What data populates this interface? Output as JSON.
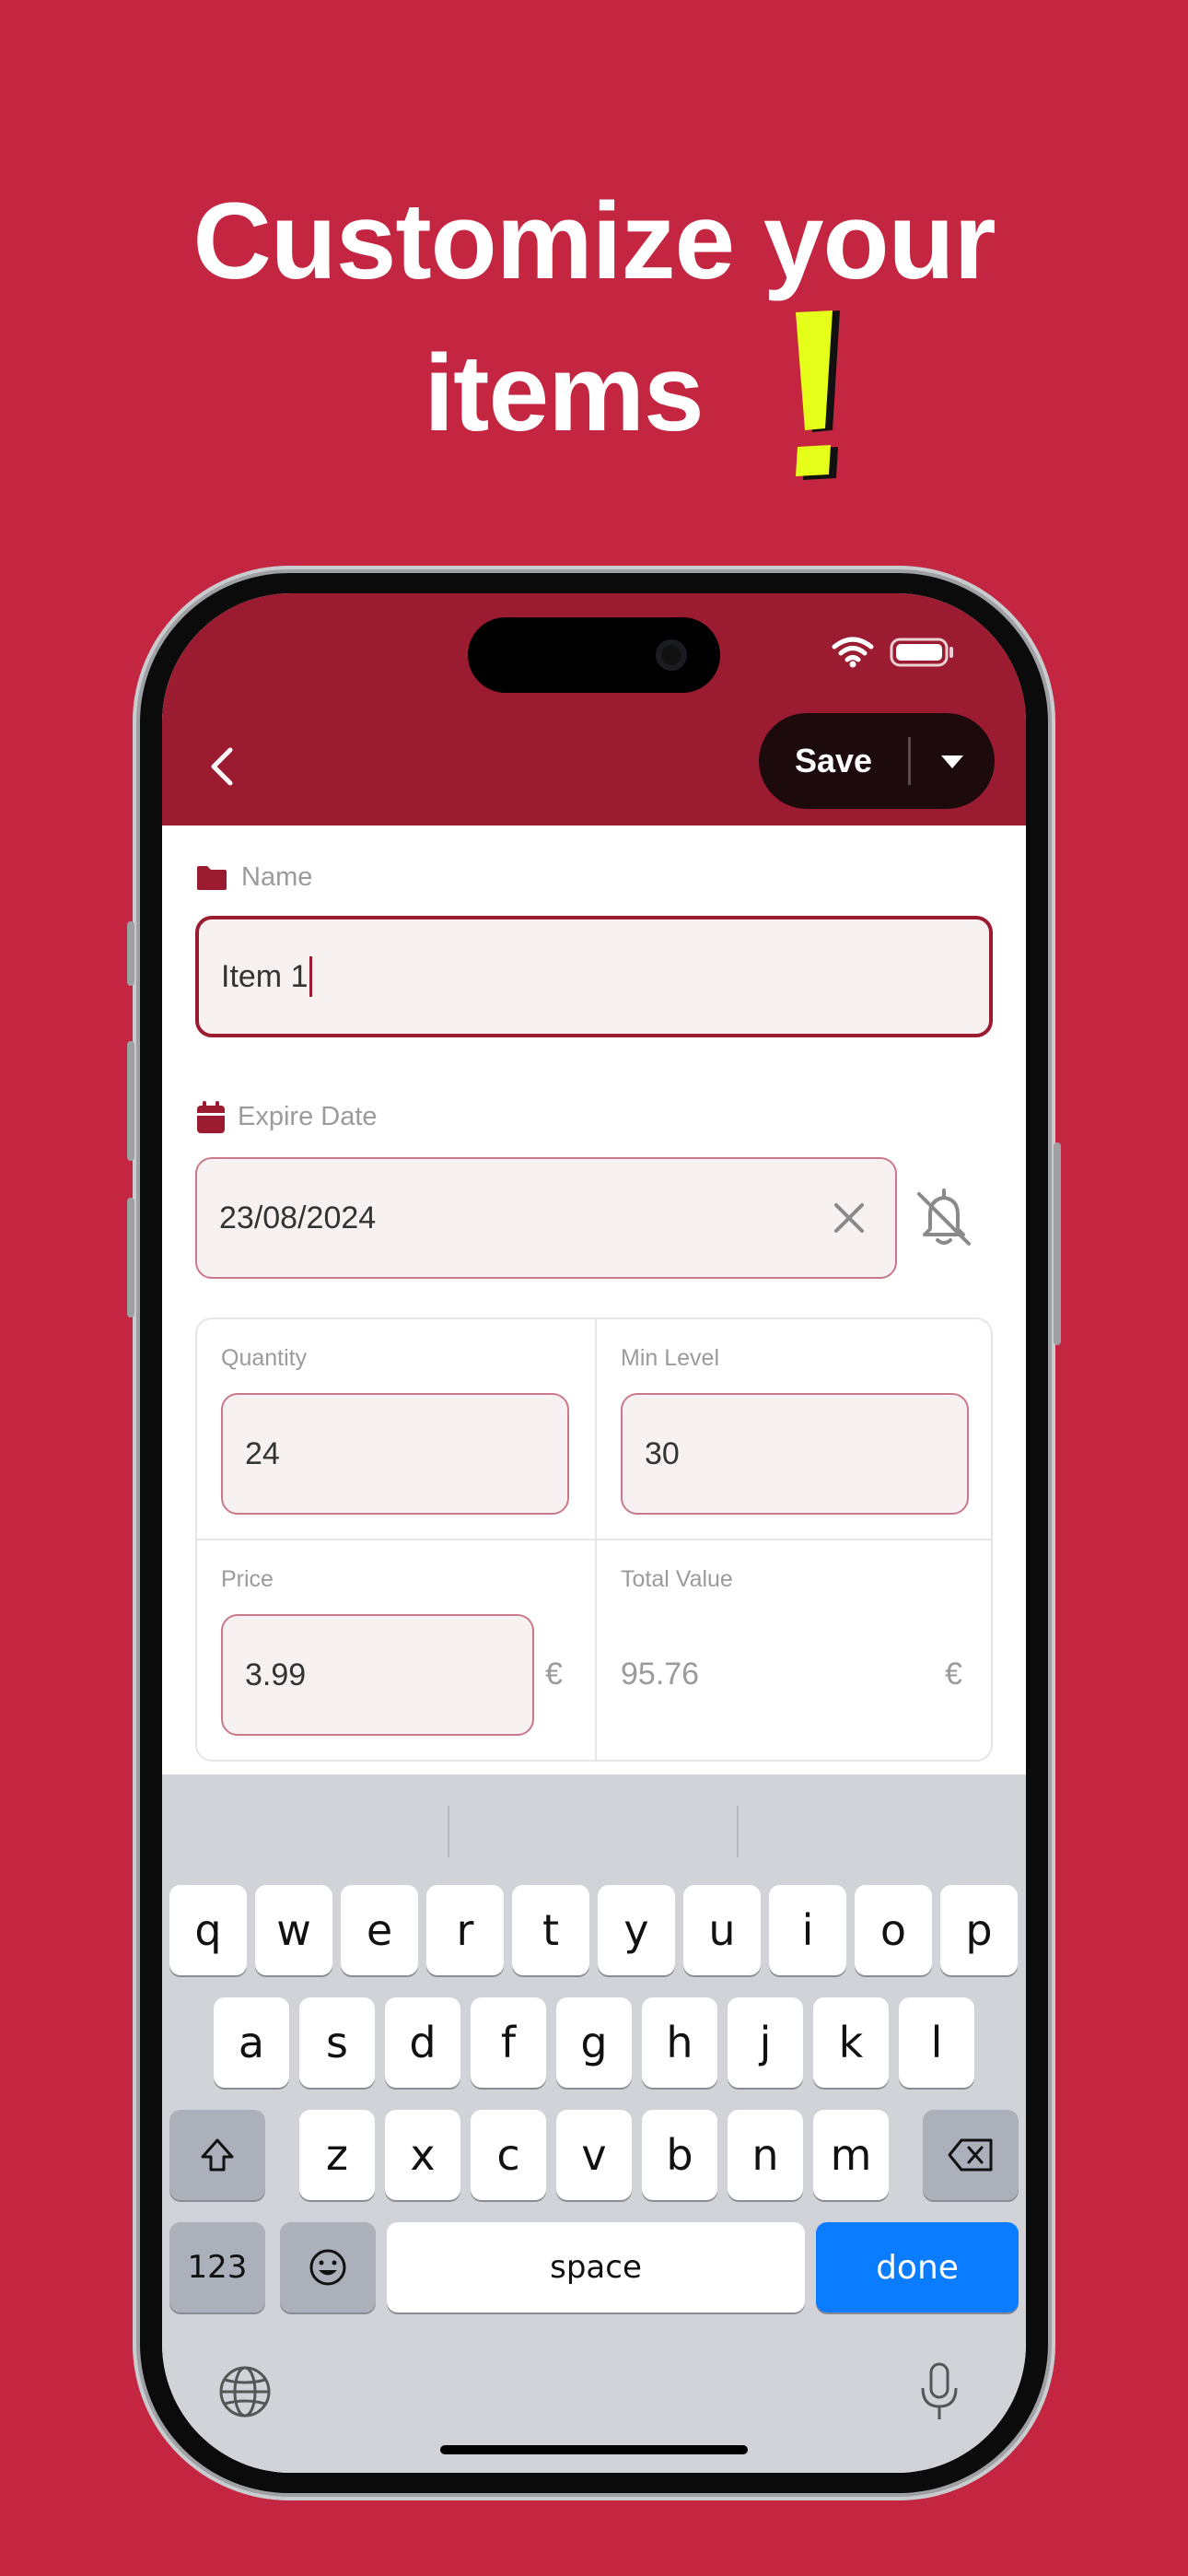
{
  "headline": {
    "line1": "Customize your",
    "line2": "items"
  },
  "topbar": {
    "save_label": "Save"
  },
  "form": {
    "name": {
      "label": "Name",
      "value": "Item 1"
    },
    "expire": {
      "label": "Expire Date",
      "value": "23/08/2024"
    },
    "quantity": {
      "label": "Quantity",
      "value": "24"
    },
    "min_level": {
      "label": "Min Level",
      "value": "30"
    },
    "price": {
      "label": "Price",
      "value": "3.99",
      "currency": "€"
    },
    "total": {
      "label": "Total Value",
      "value": "95.76",
      "currency": "€"
    }
  },
  "keyboard": {
    "row1": [
      "q",
      "w",
      "e",
      "r",
      "t",
      "y",
      "u",
      "i",
      "o",
      "p"
    ],
    "row2": [
      "a",
      "s",
      "d",
      "f",
      "g",
      "h",
      "j",
      "k",
      "l"
    ],
    "row3": [
      "z",
      "x",
      "c",
      "v",
      "b",
      "n",
      "m"
    ],
    "numbers": "123",
    "space": "space",
    "done": "done"
  },
  "colors": {
    "background": "#c42642",
    "topbar": "#9b1b30",
    "accent_yellow": "#e6ff1a",
    "done_key": "#0a7cff"
  }
}
